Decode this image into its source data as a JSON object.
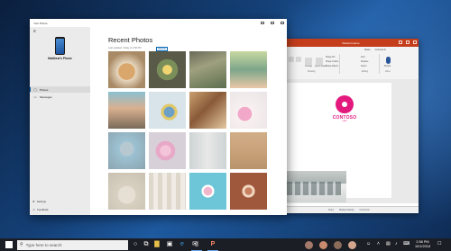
{
  "colors": {
    "accent": "#0063b1",
    "ppt_brand": "#c43e1c",
    "contoso_pink": "#e3197e"
  },
  "powerpoint": {
    "title": "Wanted Game",
    "tabs": [
      "Share",
      "Comments"
    ],
    "ribbon": {
      "groups": [
        "Drawing",
        "Editing",
        "Voice"
      ],
      "labels": [
        "Arrange",
        "Quick Styles",
        "Shape Fill",
        "Shape Outline",
        "Shape Effects",
        "Find",
        "Replace",
        "Select",
        "Dictate"
      ]
    },
    "slide": {
      "logo_text": "CONTOSO",
      "logo_sub": "CAFE"
    },
    "status": [
      "Notes",
      "Display Settings",
      "Comments"
    ]
  },
  "your_phone": {
    "window_title": "Your Phone",
    "device_name": "Matthew's Phone",
    "nav": [
      {
        "label": "Photos",
        "icon": "photos-icon",
        "glyph": "▢"
      },
      {
        "label": "Messages",
        "icon": "messages-icon",
        "glyph": "▭"
      }
    ],
    "bottom_nav": [
      {
        "label": "Settings",
        "icon": "gear-icon",
        "glyph": "⚙"
      },
      {
        "label": "Feedback",
        "icon": "feedback-icon",
        "glyph": "☺"
      }
    ],
    "section_title": "Recent Photos",
    "last_updated": "Last updated: Today at 2:56 PM",
    "refresh_label": "Refresh",
    "photos": [
      "cake on table",
      "bowls of food",
      "plant bowl",
      "group of friends",
      "pink macarons",
      "fruit cake",
      "bakery letters",
      "donuts and cups",
      "people at beach",
      "cupcakes",
      "cafe storefront",
      "bread loaf",
      "table settings",
      "pastries on counter",
      "sprinkle donut",
      "assorted donuts"
    ]
  },
  "taskbar": {
    "search_placeholder": "Type here to search",
    "apps": [
      {
        "name": "task-view-icon",
        "glyph": "⧉"
      },
      {
        "name": "file-explorer-icon",
        "glyph": "▇"
      },
      {
        "name": "store-icon",
        "glyph": "▣"
      },
      {
        "name": "edge-icon",
        "glyph": "e"
      },
      {
        "name": "mail-icon",
        "glyph": "✉"
      },
      {
        "name": "powerpoint-icon",
        "glyph": "P"
      },
      {
        "name": "your-phone-icon",
        "glyph": "▯"
      }
    ],
    "time": "2:56 PM",
    "date": "10/1/2018"
  }
}
